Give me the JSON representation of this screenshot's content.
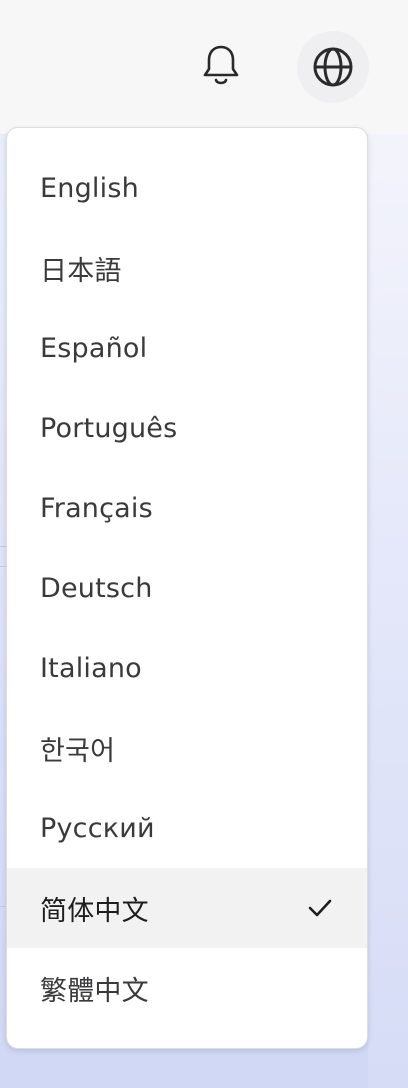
{
  "header": {
    "notifications_icon": "bell-icon",
    "language_icon": "globe-icon"
  },
  "language_menu": {
    "items": [
      {
        "label": "English",
        "selected": false
      },
      {
        "label": "日本語",
        "selected": false
      },
      {
        "label": "Español",
        "selected": false
      },
      {
        "label": "Português",
        "selected": false
      },
      {
        "label": "Français",
        "selected": false
      },
      {
        "label": "Deutsch",
        "selected": false
      },
      {
        "label": "Italiano",
        "selected": false
      },
      {
        "label": "한국어",
        "selected": false
      },
      {
        "label": "Русский",
        "selected": false
      },
      {
        "label": "简体中文",
        "selected": true
      },
      {
        "label": "繁體中文",
        "selected": false
      }
    ],
    "selected_icon": "checkmark-icon"
  },
  "colors": {
    "menu_background": "#ffffff",
    "selected_background": "#f2f2f2",
    "text": "#3a3a3c",
    "icon": "#2a2a2c"
  }
}
